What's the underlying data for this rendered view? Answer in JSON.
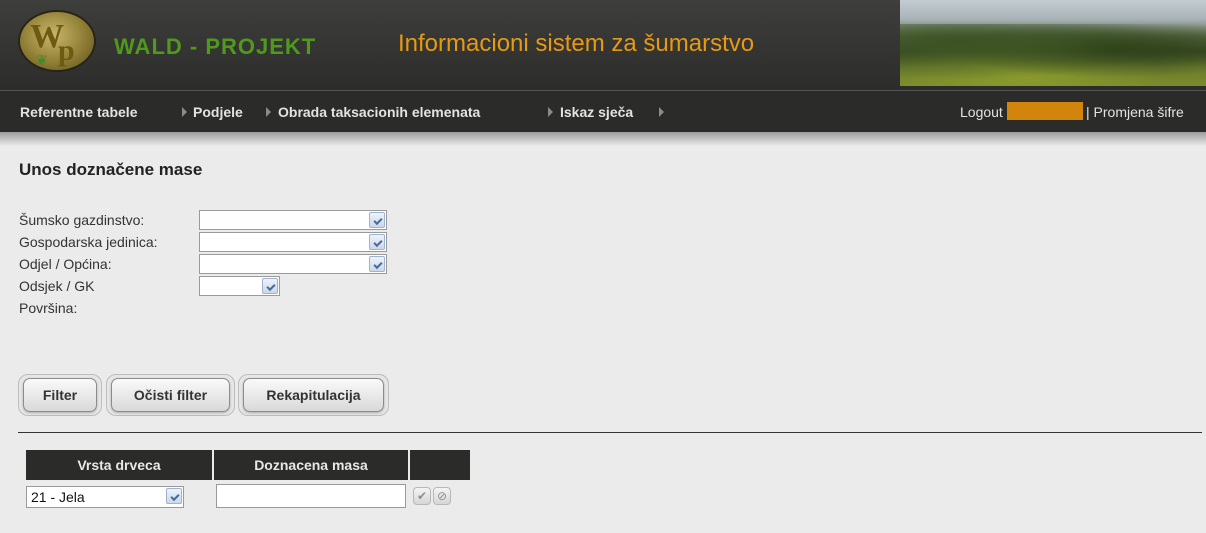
{
  "header": {
    "logo_letters": "WP",
    "brand": "WALD - PROJEKT",
    "app_title": "Informacioni sistem za šumarstvo"
  },
  "nav": {
    "items": [
      "Referentne tabele",
      "Podjele",
      "Obrada taksacionih elemenata",
      "Iskaz sječa"
    ],
    "logout": "Logout",
    "change_password": "| Promjena šifre"
  },
  "page": {
    "title": "Unos doznačene mase"
  },
  "form": {
    "fields": [
      {
        "label": "Šumsko gazdinstvo:",
        "value": ""
      },
      {
        "label": "Gospodarska jedinica:",
        "value": ""
      },
      {
        "label": "Odjel / Općina:",
        "value": ""
      },
      {
        "label": "Odsjek / GK",
        "value": ""
      },
      {
        "label": "Površina:"
      }
    ]
  },
  "buttons": {
    "filter": "Filter",
    "clear_filter": "Očisti filter",
    "recap": "Rekapitulacija"
  },
  "table": {
    "headers": [
      "Vrsta drveca",
      "Doznacena masa",
      ""
    ],
    "row": {
      "species": "21 - Jela",
      "mass": ""
    }
  },
  "colors": {
    "brand_green": "#4f9a1c",
    "title_orange": "#e69a12",
    "user_box": "#d2850d",
    "nav_bg": "#2b2b29"
  }
}
